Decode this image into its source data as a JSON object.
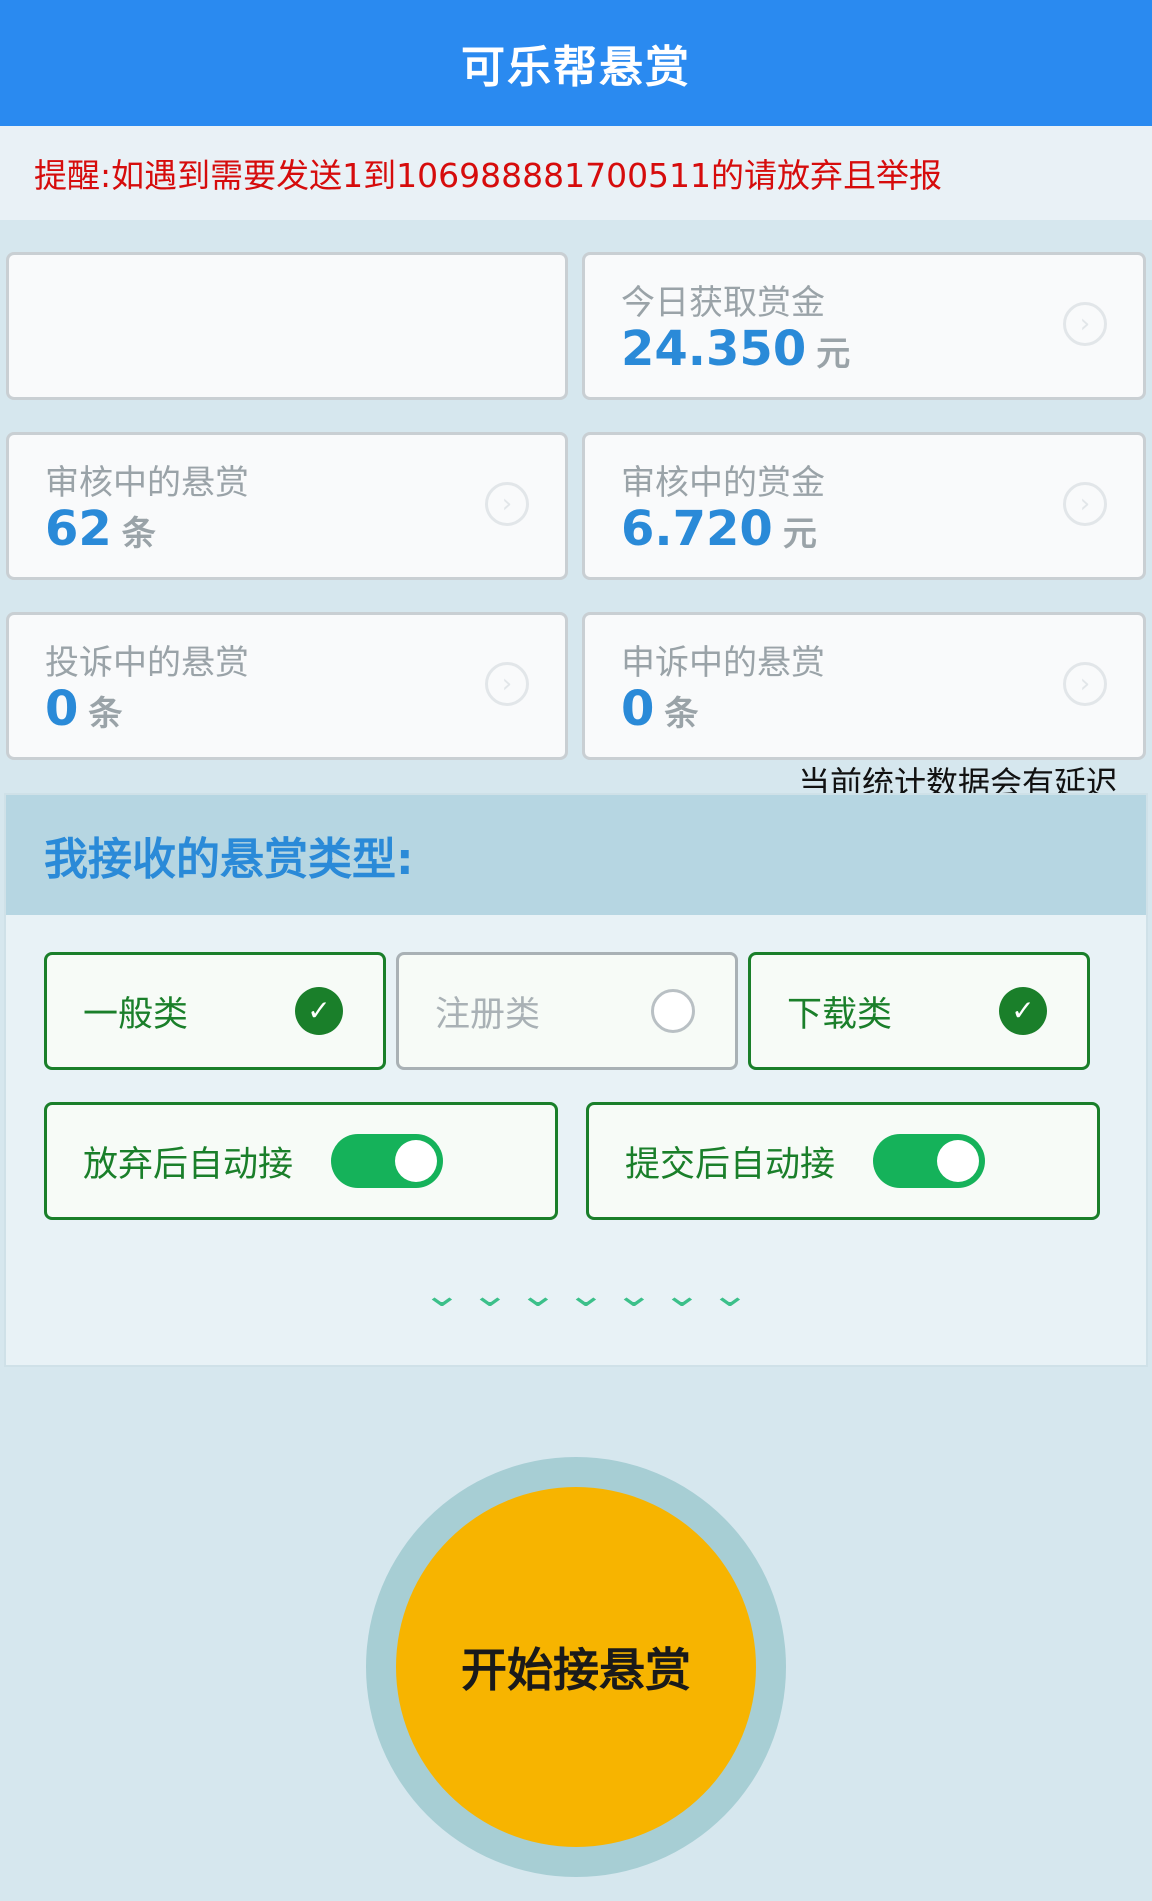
{
  "header": {
    "title": "可乐帮悬赏"
  },
  "notice": {
    "text": "提醒:如遇到需要发送1到106988881700511的请放弃且举报"
  },
  "stats": {
    "today": {
      "label": "今日获取赏金",
      "value": "24.350",
      "unit": "元"
    },
    "reviewing_tasks": {
      "label": "审核中的悬赏",
      "value": "62",
      "unit": "条"
    },
    "reviewing_money": {
      "label": "审核中的赏金",
      "value": "6.720",
      "unit": "元"
    },
    "complaint_tasks": {
      "label": "投诉中的悬赏",
      "value": "0",
      "unit": "条"
    },
    "appeal_tasks": {
      "label": "申诉中的悬赏",
      "value": "0",
      "unit": "条"
    },
    "arrow_icon": "chevron-right-circle-icon"
  },
  "delay_note": "当前统计数据会有延迟",
  "types": {
    "title": "我接收的悬赏类型:",
    "options": [
      {
        "label": "一般类",
        "checked": true
      },
      {
        "label": "注册类",
        "checked": false
      },
      {
        "label": "下载类",
        "checked": true
      }
    ],
    "toggles": [
      {
        "label": "放弃后自动接",
        "on": true
      },
      {
        "label": "提交后自动接",
        "on": true
      }
    ],
    "expand_icon": "chevron-down-icon"
  },
  "start_button": {
    "label": "开始接悬赏"
  },
  "colors": {
    "header": "#2a8af0",
    "notice_text": "#d60c0c",
    "value_blue": "#2a8ad8",
    "green": "#1a7f2a",
    "toggle_green": "#15b25a",
    "start_yellow": "#f7b400"
  }
}
